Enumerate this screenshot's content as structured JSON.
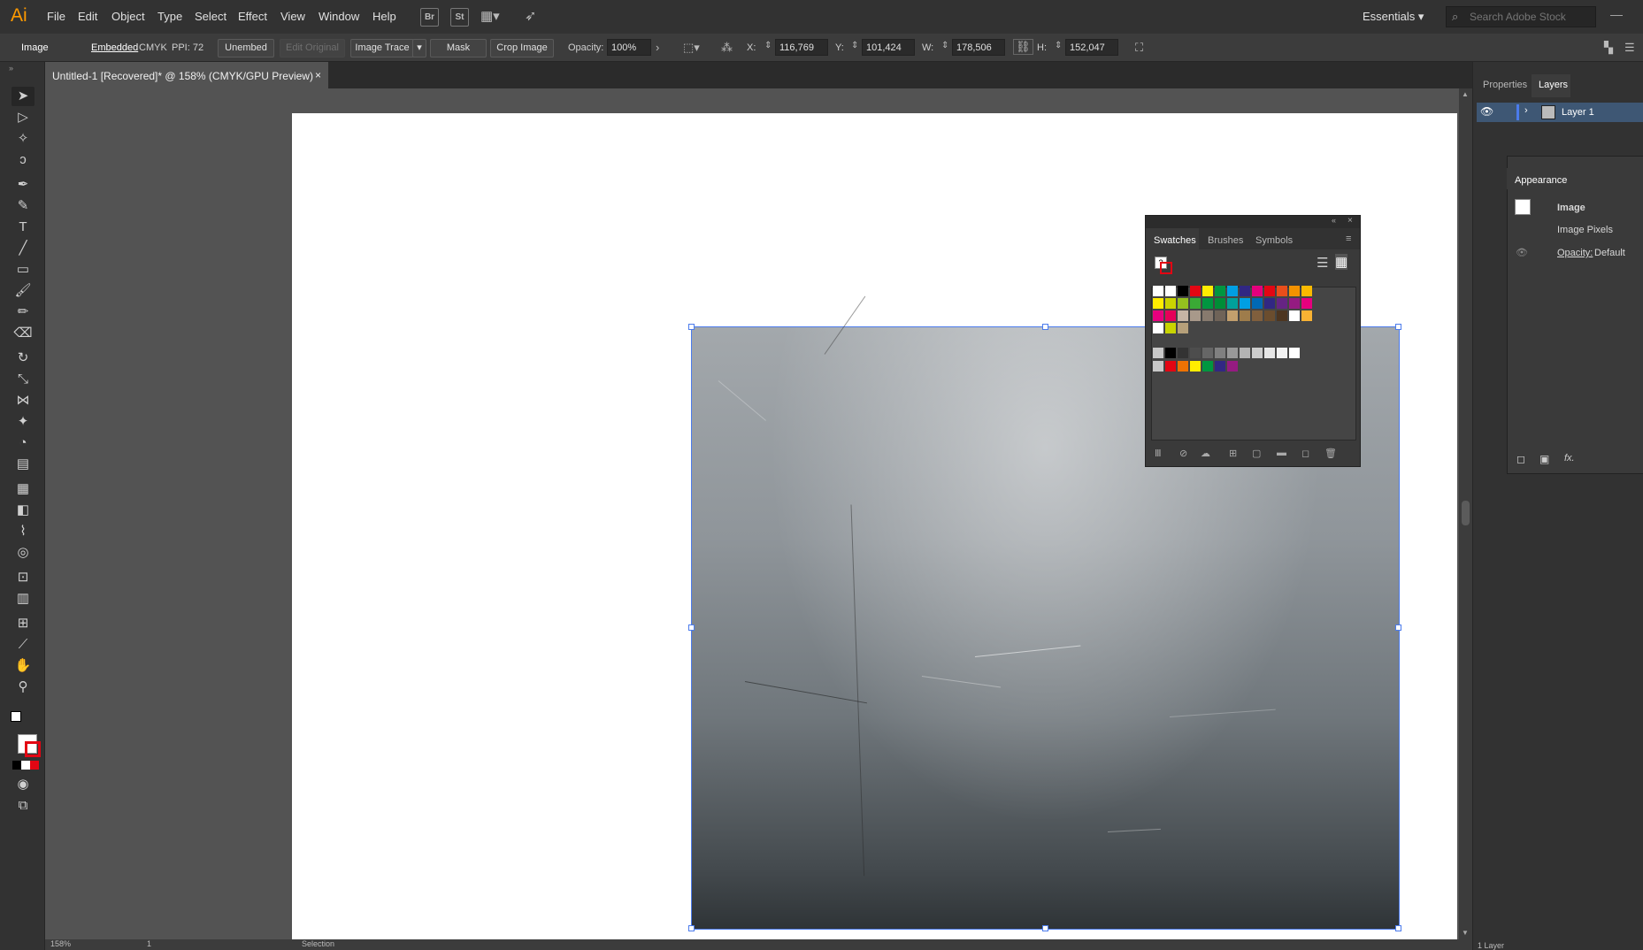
{
  "app": {
    "logo": "Ai",
    "accent": "#ff9a00"
  },
  "menu": [
    "File",
    "Edit",
    "Object",
    "Type",
    "Select",
    "Effect",
    "View",
    "Window",
    "Help"
  ],
  "menubar_icons": {
    "bridge": "Br",
    "stock": "St"
  },
  "workspace": {
    "label": "Essentials"
  },
  "search": {
    "placeholder": "Search Adobe Stock"
  },
  "control_bar": {
    "object_type": "Image",
    "embedded": "Embedded",
    "color_mode": "CMYK",
    "ppi": "PPI: 72",
    "unembed": "Unembed",
    "edit_original": "Edit Original",
    "image_trace": "Image Trace",
    "mask": "Mask",
    "crop_image": "Crop Image",
    "opacity_label": "Opacity:",
    "opacity_value": "100%",
    "x_label": "X:",
    "x_value": "116,769 mm",
    "y_label": "Y:",
    "y_value": "101,424 mm",
    "w_label": "W:",
    "w_value": "178,506 mm",
    "h_label": "H:",
    "h_value": "152,047 mm"
  },
  "document": {
    "tab_title": "Untitled-1 [Recovered]* @ 158% (CMYK/GPU Preview)",
    "close": "×"
  },
  "status_bar": {
    "zoom": "158%",
    "artboard": "1",
    "tool": "Selection"
  },
  "swatches": {
    "tabs": [
      "Swatches",
      "Brushes",
      "Symbols"
    ],
    "rows": [
      [
        "#ffffff",
        "#ffffff",
        "#000000",
        "#e30613",
        "#ffed00",
        "#009640",
        "#009fe3",
        "#312783",
        "#e5007d",
        "#e30613",
        "#e94e1b",
        "#f39200",
        "#fbba00"
      ],
      [
        "#ffed00",
        "#cad400",
        "#95c11f",
        "#3aaa35",
        "#009640",
        "#008d36",
        "#00a19a",
        "#009fe3",
        "#0069b4",
        "#312783",
        "#662483",
        "#951b81",
        "#e6007e"
      ],
      [
        "#e6007e",
        "#e50059",
        "#c6b5a5",
        "#a8998a",
        "#877a6e",
        "#6f6358",
        "#c29f6d",
        "#9e7c4b",
        "#805f3d",
        "#6b4d2e",
        "#4d3520",
        "#ffffff",
        "#f9b233"
      ],
      [
        "#ffffff",
        "#c8d400",
        "#b6a07a"
      ],
      [
        "#c8c8c8",
        "#000000",
        "#333333",
        "#4d4d4d",
        "#666666",
        "#808080",
        "#999999",
        "#b3b3b3",
        "#cccccc",
        "#e6e6e6",
        "#f2f2f2",
        "#ffffff"
      ],
      [
        "#c8c8c8",
        "#e30613",
        "#ee7203",
        "#ffed00",
        "#009640",
        "#312783",
        "#951b81"
      ]
    ]
  },
  "right_dock": {
    "tabs": [
      "Properties",
      "Layers"
    ],
    "layer_name": "Layer 1",
    "layers_count": "1 Layer",
    "appearance": {
      "title": "Appearance",
      "object": "Image",
      "pixels": "Image Pixels",
      "opacity_label": "Opacity:",
      "opacity_value": "Default"
    }
  }
}
